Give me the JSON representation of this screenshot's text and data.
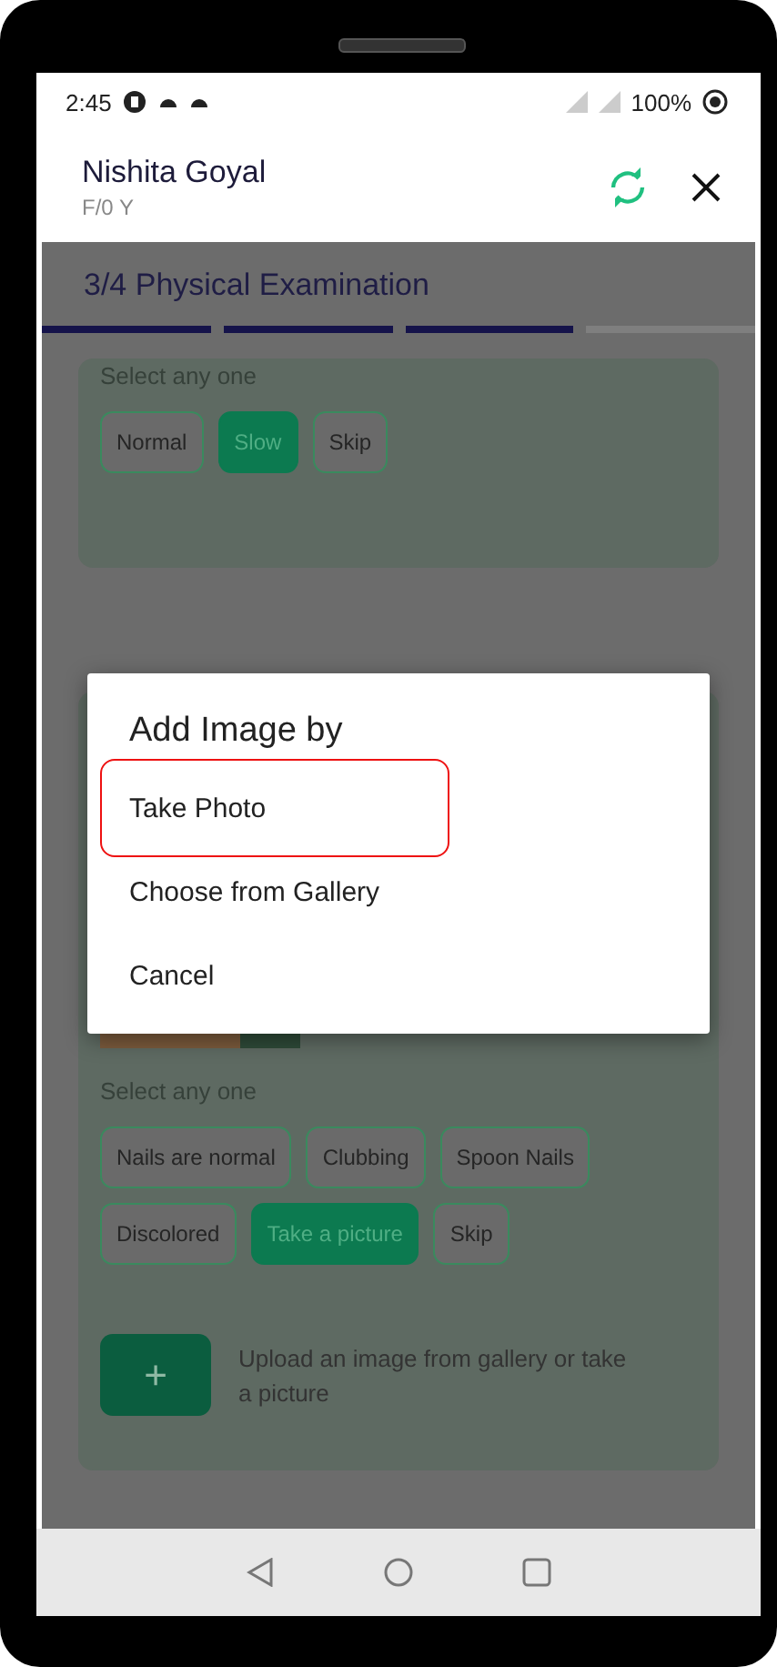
{
  "status_bar": {
    "time": "2:45",
    "battery": "100%"
  },
  "header": {
    "name": "Nishita Goyal",
    "subtitle": "F/0 Y"
  },
  "step": {
    "title": "3/4 Physical Examination",
    "segments": [
      {
        "done": true
      },
      {
        "done": true
      },
      {
        "done": true
      },
      {
        "done": false
      }
    ]
  },
  "sections": [
    {
      "prompt": "Select any one",
      "has_photo": false,
      "options": [
        {
          "label": "Normal",
          "selected": false
        },
        {
          "label": "Slow",
          "selected": true
        },
        {
          "label": "Skip",
          "selected": false
        }
      ]
    },
    {
      "prompt": "Select any one",
      "has_photo": true,
      "options": [
        {
          "label": "Nails are normal",
          "selected": false
        },
        {
          "label": "Clubbing",
          "selected": false
        },
        {
          "label": "Spoon Nails",
          "selected": false
        },
        {
          "label": "Discolored",
          "selected": false
        },
        {
          "label": "Take a picture",
          "selected": true
        },
        {
          "label": "Skip",
          "selected": false
        }
      ],
      "upload": {
        "icon": "+",
        "text": "Upload an image from gallery or take a picture"
      }
    }
  ],
  "dialog": {
    "title": "Add Image by",
    "items": [
      {
        "label": "Take Photo",
        "highlighted": true
      },
      {
        "label": "Choose from Gallery",
        "highlighted": false
      },
      {
        "label": "Cancel",
        "highlighted": false
      }
    ]
  }
}
